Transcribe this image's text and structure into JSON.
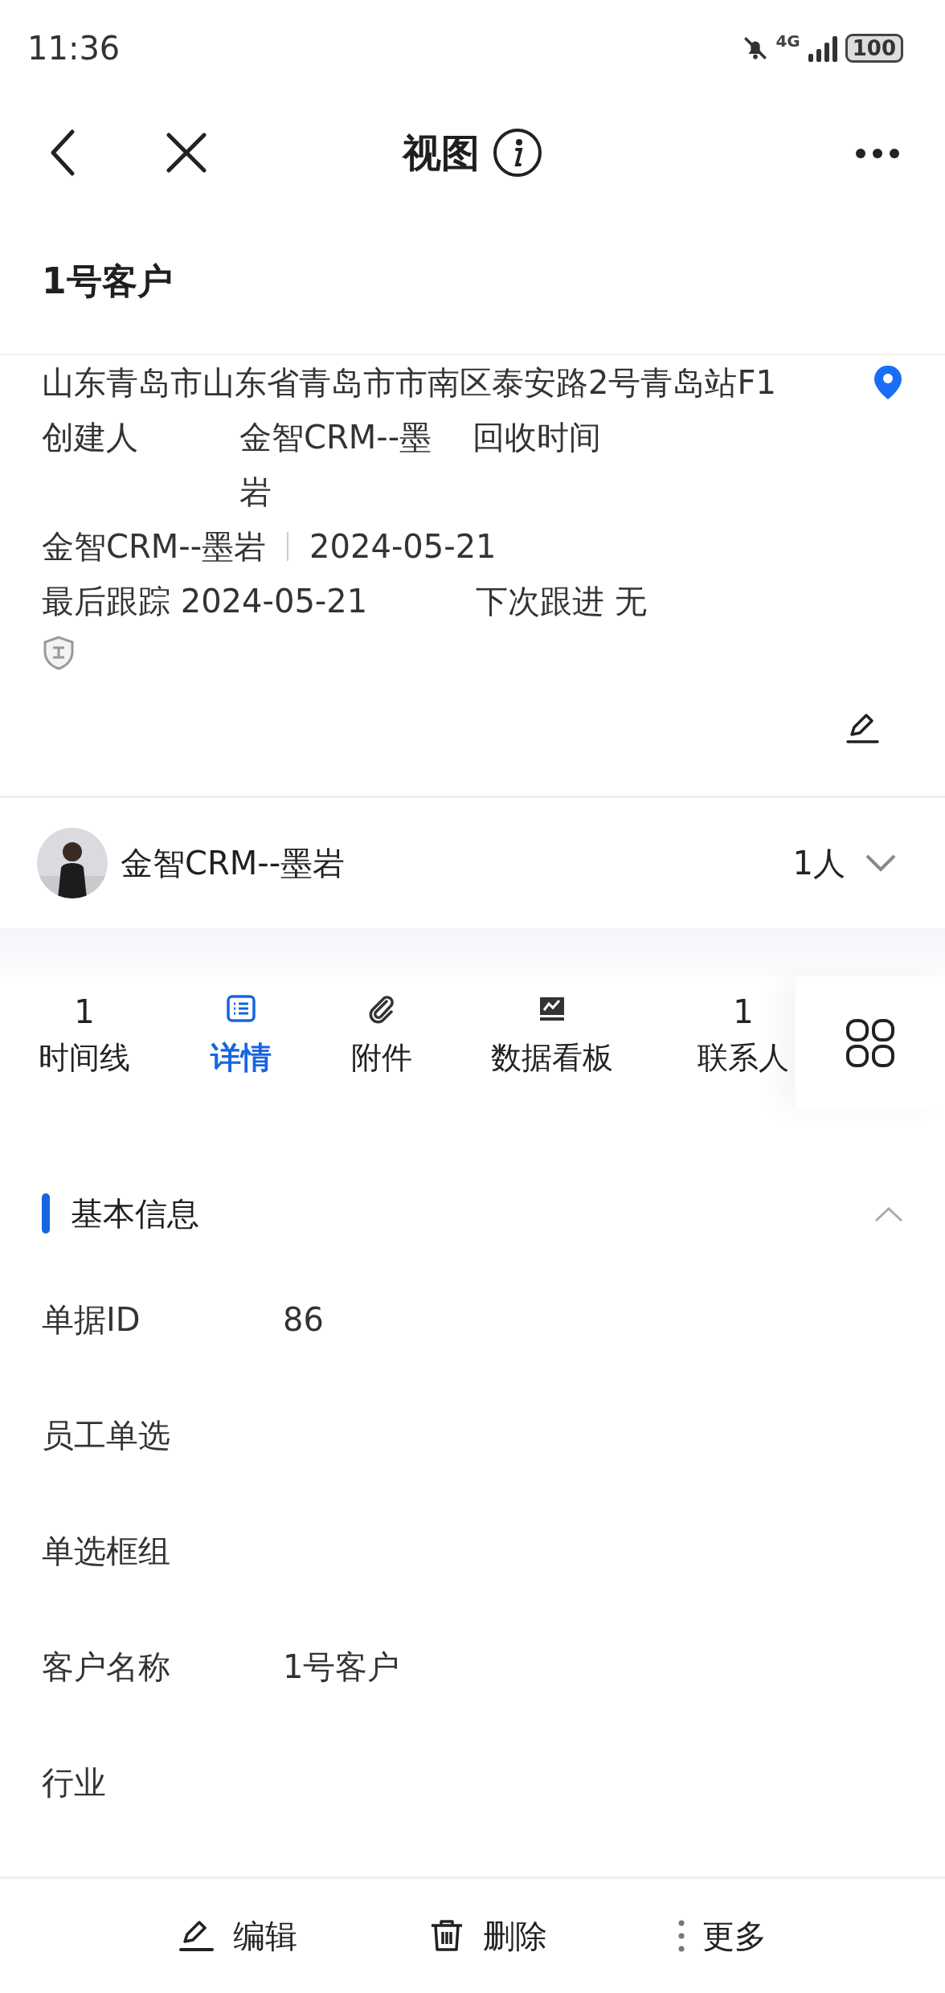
{
  "status_bar": {
    "time": "11:36",
    "network": "4G",
    "battery": "100"
  },
  "header": {
    "title": "视图"
  },
  "record": {
    "title": "1号客户",
    "address": "山东青岛市山东省青岛市市南区泰安路2号青岛站F1",
    "creator_label": "创建人",
    "creator_value": "金智CRM--墨岩",
    "reclaim_label": "回收时间",
    "owner": "金智CRM--墨岩",
    "date": "2024-05-21",
    "last_follow": "最后跟踪 2024-05-21",
    "next_follow": "下次跟进 无"
  },
  "members": {
    "name": "金智CRM--墨岩",
    "count": "1人",
    "expanded": false
  },
  "tabs": [
    {
      "kind": "count",
      "count": "1",
      "label": "时间线",
      "selected": false
    },
    {
      "kind": "icon",
      "label": "详情",
      "selected": true
    },
    {
      "kind": "icon",
      "label": "附件",
      "selected": false
    },
    {
      "kind": "icon",
      "label": "数据看板",
      "selected": false
    },
    {
      "kind": "count",
      "count": "1",
      "label": "联系人",
      "selected": false
    }
  ],
  "section": {
    "title": "基本信息",
    "expanded": true
  },
  "fields": [
    {
      "label": "单据ID",
      "value": "86"
    },
    {
      "label": "员工单选"
    },
    {
      "label": "单选框组"
    },
    {
      "label": "客户名称",
      "value": "1号客户"
    },
    {
      "label": "行业"
    }
  ],
  "actions": [
    {
      "kind": "edit",
      "label": "编辑"
    },
    {
      "kind": "delete",
      "label": "删除"
    },
    {
      "kind": "more",
      "label": "更多"
    }
  ]
}
